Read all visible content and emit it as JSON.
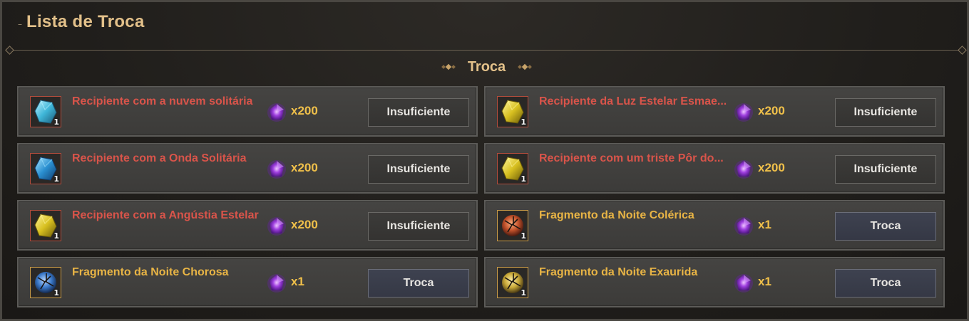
{
  "window": {
    "title": "Lista de Troca"
  },
  "section": {
    "title": "Troca"
  },
  "rows": [
    {
      "name": "Recipiente com a nuvem solitária",
      "name_color": "red",
      "icon": "cyan-crystal-icon",
      "qty": "1",
      "cost": "x200",
      "button": "Insuficiente",
      "enabled": false
    },
    {
      "name": "Recipiente da Luz Estelar Esmae...",
      "name_color": "red",
      "icon": "yellow-crystal-icon",
      "qty": "1",
      "cost": "x200",
      "button": "Insuficiente",
      "enabled": false
    },
    {
      "name": "Recipiente com a Onda Solitária",
      "name_color": "red",
      "icon": "blue-crystal-icon",
      "qty": "1",
      "cost": "x200",
      "button": "Insuficiente",
      "enabled": false
    },
    {
      "name": "Recipiente com um triste Pôr do...",
      "name_color": "red",
      "icon": "yellow-crystal-icon",
      "qty": "1",
      "cost": "x200",
      "button": "Insuficiente",
      "enabled": false
    },
    {
      "name": "Recipiente com a Angústia Estelar",
      "name_color": "red",
      "icon": "yellow-crystal-icon",
      "qty": "1",
      "cost": "x200",
      "button": "Insuficiente",
      "enabled": false
    },
    {
      "name": "Fragmento da Noite Colérica",
      "name_color": "gold",
      "icon": "red-fragment-icon",
      "qty": "1",
      "cost": "x1",
      "button": "Troca",
      "enabled": true
    },
    {
      "name": "Fragmento da Noite Chorosa",
      "name_color": "gold",
      "icon": "blue-fragment-icon",
      "qty": "1",
      "cost": "x1",
      "button": "Troca",
      "enabled": true
    },
    {
      "name": "Fragmento da Noite Exaurida",
      "name_color": "gold",
      "icon": "yellow-fragment-icon",
      "qty": "1",
      "cost": "x1",
      "button": "Troca",
      "enabled": true
    }
  ],
  "currency_icon": "purple-gem-icon",
  "colors": {
    "title": "#e3c18a",
    "name_unavailable": "#d9544a",
    "name_available": "#e8b445",
    "cost": "#f0c04a"
  }
}
